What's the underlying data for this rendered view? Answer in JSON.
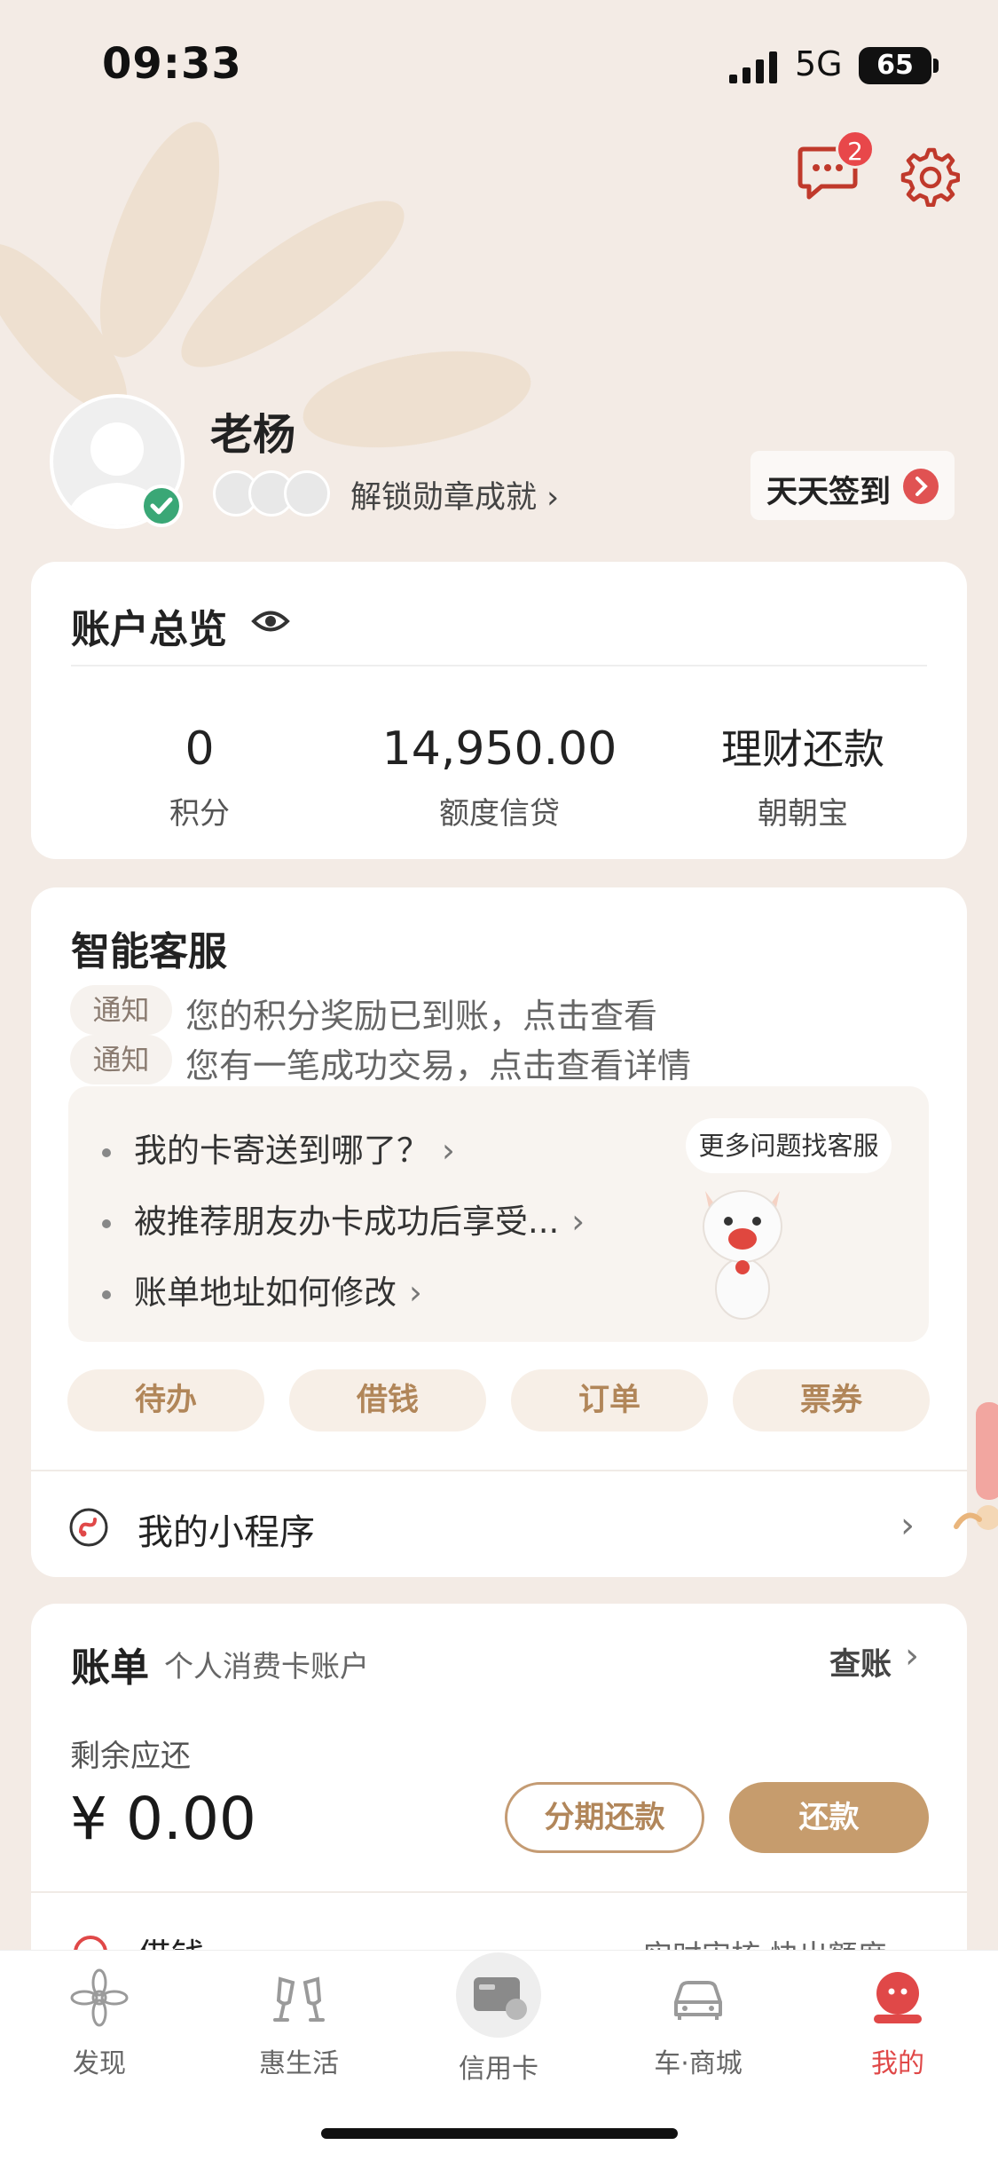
{
  "status_bar": {
    "time": "09:33",
    "network": "5G",
    "battery": "65"
  },
  "header": {
    "message_badge": "2"
  },
  "profile": {
    "name": "老杨",
    "unlock_text": "解锁勋章成就 ›",
    "checkin_label": "天天签到"
  },
  "overview": {
    "title": "账户总览",
    "items": [
      {
        "value": "0",
        "label": "积分"
      },
      {
        "value": "14,950.00",
        "label": "额度信贷"
      },
      {
        "value": "理财还款",
        "label": "朝朝宝"
      }
    ]
  },
  "service": {
    "title": "智能客服",
    "notices": [
      {
        "tag": "通知",
        "text": "您的积分奖励已到账，点击查看"
      },
      {
        "tag": "通知",
        "text": "您有一笔成功交易，点击查看详情"
      }
    ],
    "faqs": [
      "我的卡寄送到哪了？",
      "被推荐朋友办卡成功后享受...",
      "账单地址如何修改"
    ],
    "more_label": "更多问题找客服",
    "quick_buttons": [
      "待办",
      "借钱",
      "订单",
      "票券"
    ],
    "mini_program_label": "我的小程序"
  },
  "bill": {
    "title": "账单",
    "subtitle": "个人消费卡账户",
    "check_label": "查账",
    "remain_label": "剩余应还",
    "remain_amount": "¥ 0.00",
    "installment_label": "分期还款",
    "repay_label": "还款",
    "borrow_label": "借钱",
    "borrow_sub": "实时审核 快出额度 ›"
  },
  "tabs": [
    {
      "label": "发现",
      "icon": "discover-flower-icon",
      "active": false
    },
    {
      "label": "惠生活",
      "icon": "cheers-glasses-icon",
      "active": false
    },
    {
      "label": "信用卡",
      "icon": "credit-card-icon",
      "active": false
    },
    {
      "label": "车·商城",
      "icon": "car-icon",
      "active": false
    },
    {
      "label": "我的",
      "icon": "me-avatar-icon",
      "active": true
    }
  ],
  "colors": {
    "background": "#f3ebe5",
    "accent_gold": "#c69c6d",
    "accent_red": "#e04848",
    "verified_green": "#3aa776"
  }
}
